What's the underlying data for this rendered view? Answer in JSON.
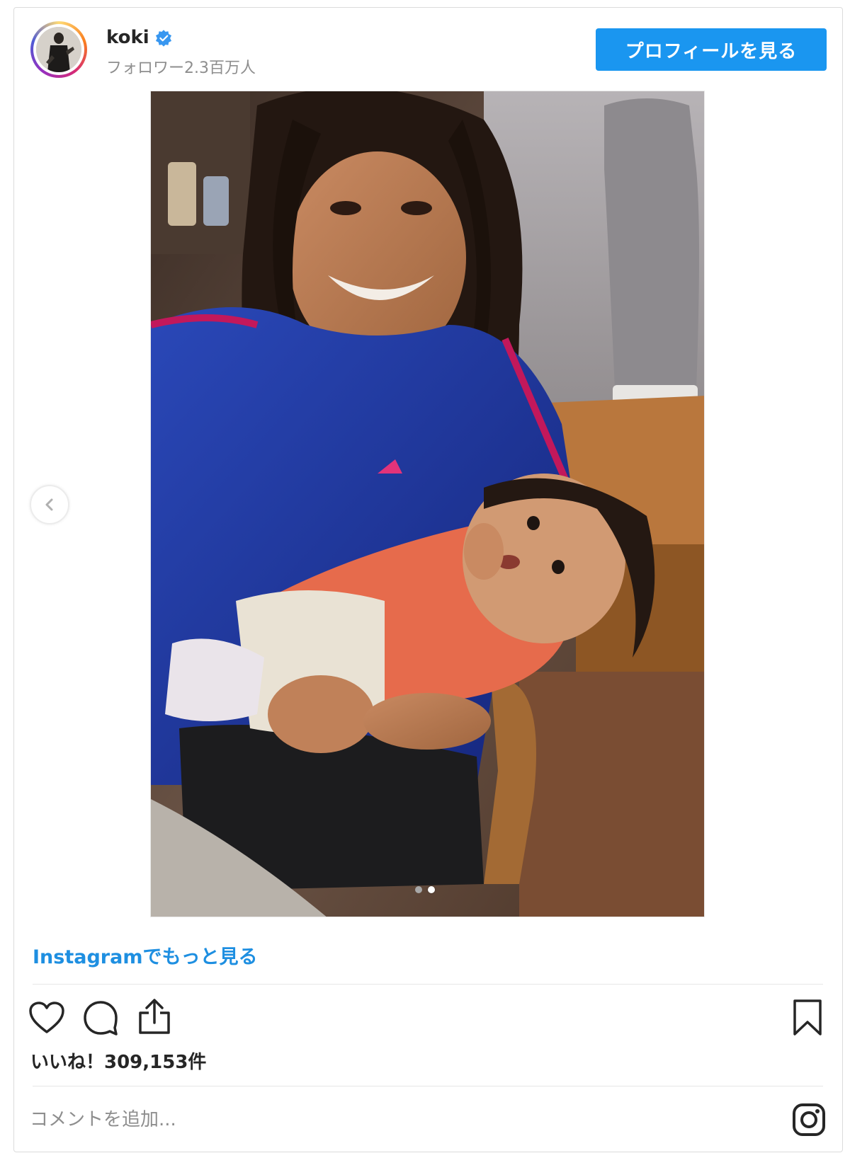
{
  "header": {
    "username": "koki",
    "followers": "フォロワー2.3百万人",
    "profile_button": "プロフィールを見る"
  },
  "post": {
    "carousel_total": 2,
    "carousel_active": 2,
    "see_more": "Instagramでもっと見る",
    "likes": "いいね！309,153件",
    "comment_placeholder": "コメントを追加..."
  },
  "colors": {
    "accent": "#1a96f0",
    "link": "#1e8fe1",
    "text": "#262626",
    "muted": "#8e8e8e"
  },
  "icons": [
    "verified-badge-icon",
    "chevron-left-icon",
    "heart-icon",
    "comment-icon",
    "share-icon",
    "bookmark-icon",
    "instagram-icon"
  ]
}
